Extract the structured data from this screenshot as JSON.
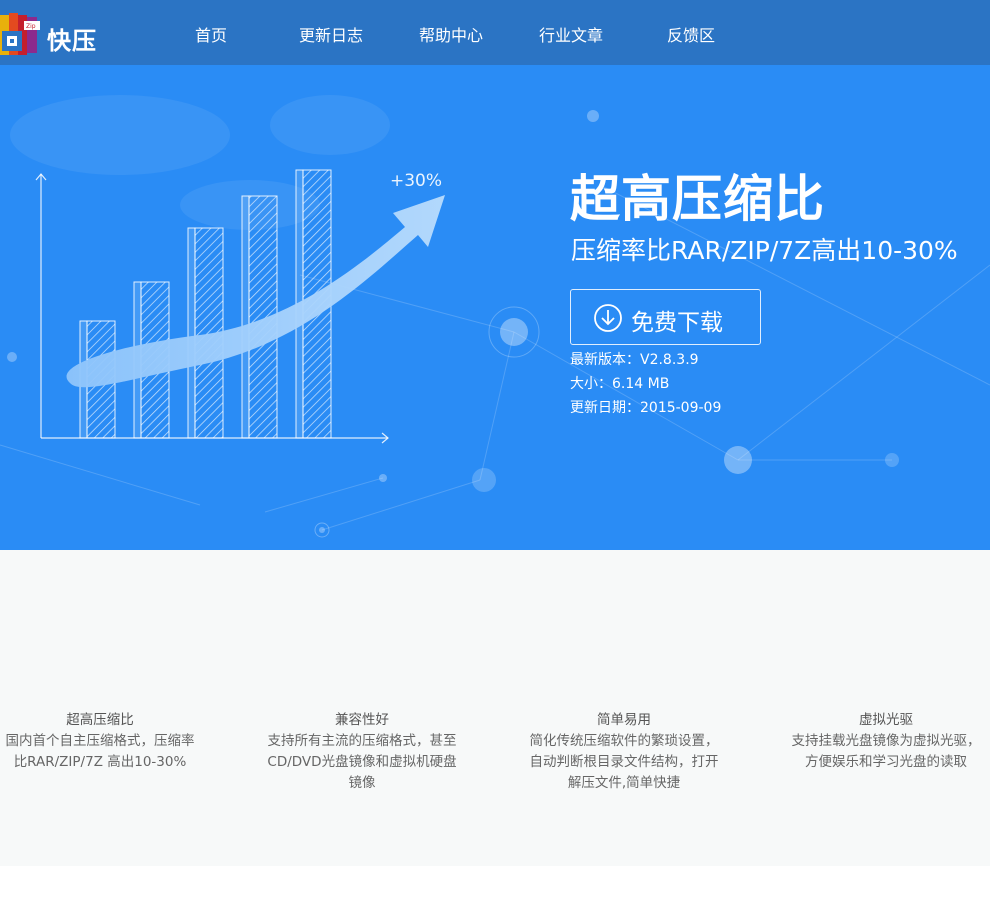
{
  "brand": {
    "name": "快压",
    "logo_badge": "Zip"
  },
  "nav": {
    "items": [
      {
        "label": "首页"
      },
      {
        "label": "更新日志"
      },
      {
        "label": "帮助中心"
      },
      {
        "label": "行业文章"
      },
      {
        "label": "反馈区"
      }
    ]
  },
  "hero": {
    "title": "超高压缩比",
    "subtitle": "压缩率比RAR/ZIP/7Z高出10-30%",
    "chart_label": "+30%",
    "download_label": "免费下载",
    "version": "最新版本：V2.8.3.9",
    "size": "大小：6.14 MB",
    "date": "更新日期：2015-09-09"
  },
  "features": [
    {
      "title": "超高压缩比",
      "desc": [
        "国内首个自主压缩格式，压缩率",
        "比RAR/ZIP/7Z 高出10-30%"
      ]
    },
    {
      "title": "兼容性好",
      "desc": [
        "支持所有主流的压缩格式，甚至",
        "CD/DVD光盘镜像和虚拟机硬盘",
        "镜像"
      ]
    },
    {
      "title": "简单易用",
      "desc": [
        "简化传统压缩软件的繁琐设置，",
        "自动判断根目录文件结构，打开",
        "解压文件,简单快捷"
      ]
    },
    {
      "title": "虚拟光驱",
      "desc": [
        "支持挂载光盘镜像为虚拟光驱，",
        "方便娱乐和学习光盘的读取"
      ]
    }
  ],
  "colors": {
    "header": "#2b74c4",
    "hero": "#2a8cf5",
    "features_bg": "#f7f9f9"
  }
}
